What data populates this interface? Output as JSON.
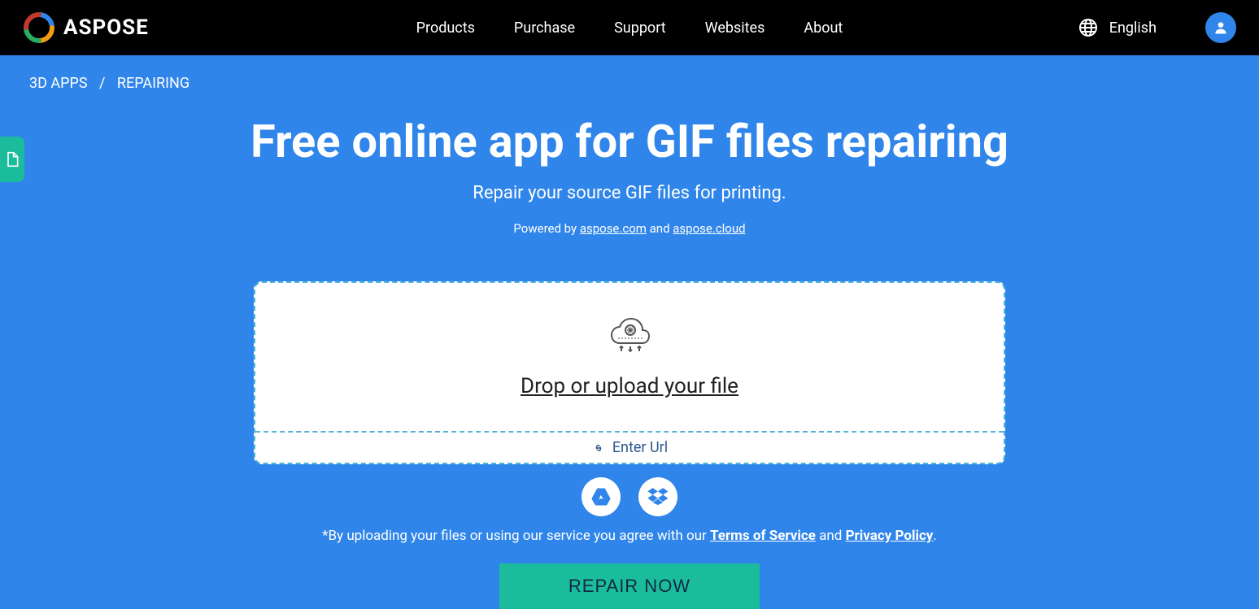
{
  "header": {
    "brand": "ASPOSE",
    "nav": [
      "Products",
      "Purchase",
      "Support",
      "Websites",
      "About"
    ],
    "language": "English"
  },
  "breadcrumb": {
    "root": "3D APPS",
    "current": "REPAIRING"
  },
  "hero": {
    "title": "Free online app for GIF files repairing",
    "subtitle": "Repair your source GIF files for printing.",
    "powered_prefix": "Powered by ",
    "powered_link1": "aspose.com",
    "powered_and": " and ",
    "powered_link2": "aspose.cloud"
  },
  "upload": {
    "drop_text": "Drop or upload your file",
    "enter_url": "Enter Url"
  },
  "terms": {
    "prefix": "*By uploading your files or using our service you agree with our ",
    "tos": "Terms of Service",
    "and": " and ",
    "privacy": "Privacy Policy",
    "suffix": "."
  },
  "action": {
    "repair_label": "REPAIR NOW"
  }
}
